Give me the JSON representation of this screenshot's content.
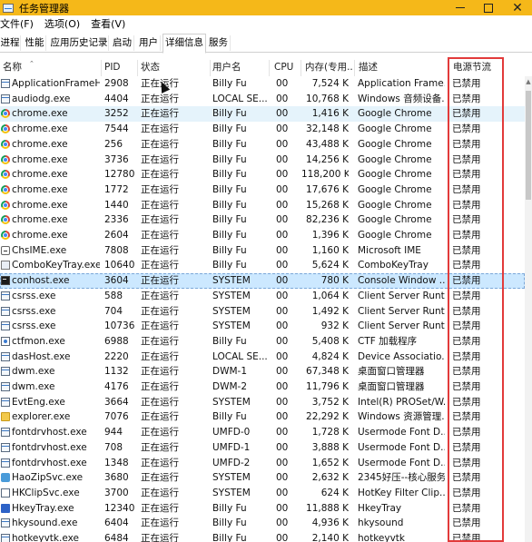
{
  "window": {
    "title": "任务管理器",
    "minimize_icon": "minimize-icon",
    "maximize_icon": "maximize-icon",
    "close_icon": "close-icon",
    "close_glyph": "✕"
  },
  "menu": [
    {
      "label": "文件(F)"
    },
    {
      "label": "选项(O)"
    },
    {
      "label": "查看(V)"
    }
  ],
  "tabs": [
    {
      "label": "进程",
      "active": false
    },
    {
      "label": "性能",
      "active": false
    },
    {
      "label": "应用历史记录",
      "active": false
    },
    {
      "label": "启动",
      "active": false
    },
    {
      "label": "用户",
      "active": false
    },
    {
      "label": "详细信息",
      "active": true
    },
    {
      "label": "服务",
      "active": false
    }
  ],
  "columns": {
    "name": "名称",
    "pid": "PID",
    "status": "状态",
    "user": "用户名",
    "cpu": "CPU",
    "memory": "内存(专用...",
    "desc": "描述",
    "power": "电源节流"
  },
  "highlight_color": "#e23b3b",
  "processes": [
    {
      "name": "ApplicationFrameH...",
      "icon": "generic",
      "pid": "2908",
      "status": "正在运行",
      "user": "Billy Fu",
      "cpu": "00",
      "mem": "7,524 K",
      "desc": "Application Frame...",
      "power": "已禁用"
    },
    {
      "name": "audiodg.exe",
      "icon": "generic",
      "pid": "4404",
      "status": "正在运行",
      "user": "LOCAL SE...",
      "cpu": "00",
      "mem": "10,768 K",
      "desc": "Windows 音频设备...",
      "power": "已禁用"
    },
    {
      "name": "chrome.exe",
      "icon": "chrome",
      "pid": "3252",
      "status": "正在运行",
      "user": "Billy Fu",
      "cpu": "00",
      "mem": "1,416 K",
      "desc": "Google Chrome",
      "power": "已禁用"
    },
    {
      "name": "chrome.exe",
      "icon": "chrome",
      "pid": "7544",
      "status": "正在运行",
      "user": "Billy Fu",
      "cpu": "00",
      "mem": "32,148 K",
      "desc": "Google Chrome",
      "power": "已禁用"
    },
    {
      "name": "chrome.exe",
      "icon": "chrome",
      "pid": "256",
      "status": "正在运行",
      "user": "Billy Fu",
      "cpu": "00",
      "mem": "43,488 K",
      "desc": "Google Chrome",
      "power": "已禁用"
    },
    {
      "name": "chrome.exe",
      "icon": "chrome",
      "pid": "3736",
      "status": "正在运行",
      "user": "Billy Fu",
      "cpu": "00",
      "mem": "14,256 K",
      "desc": "Google Chrome",
      "power": "已禁用"
    },
    {
      "name": "chrome.exe",
      "icon": "chrome",
      "pid": "12780",
      "status": "正在运行",
      "user": "Billy Fu",
      "cpu": "00",
      "mem": "118,200 K",
      "desc": "Google Chrome",
      "power": "已禁用"
    },
    {
      "name": "chrome.exe",
      "icon": "chrome",
      "pid": "1772",
      "status": "正在运行",
      "user": "Billy Fu",
      "cpu": "00",
      "mem": "17,676 K",
      "desc": "Google Chrome",
      "power": "已禁用"
    },
    {
      "name": "chrome.exe",
      "icon": "chrome",
      "pid": "1440",
      "status": "正在运行",
      "user": "Billy Fu",
      "cpu": "00",
      "mem": "15,268 K",
      "desc": "Google Chrome",
      "power": "已禁用"
    },
    {
      "name": "chrome.exe",
      "icon": "chrome",
      "pid": "2336",
      "status": "正在运行",
      "user": "Billy Fu",
      "cpu": "00",
      "mem": "82,236 K",
      "desc": "Google Chrome",
      "power": "已禁用"
    },
    {
      "name": "chrome.exe",
      "icon": "chrome",
      "pid": "2604",
      "status": "正在运行",
      "user": "Billy Fu",
      "cpu": "00",
      "mem": "1,396 K",
      "desc": "Google Chrome",
      "power": "已禁用"
    },
    {
      "name": "ChsIME.exe",
      "icon": "ime",
      "pid": "7808",
      "status": "正在运行",
      "user": "Billy Fu",
      "cpu": "00",
      "mem": "1,160 K",
      "desc": "Microsoft IME",
      "power": "已禁用"
    },
    {
      "name": "ComboKeyTray.exe",
      "icon": "keyb",
      "pid": "10640",
      "status": "正在运行",
      "user": "Billy Fu",
      "cpu": "00",
      "mem": "5,624 K",
      "desc": "ComboKeyTray",
      "power": "已禁用"
    },
    {
      "name": "conhost.exe",
      "icon": "console",
      "pid": "3604",
      "status": "正在运行",
      "user": "SYSTEM",
      "cpu": "00",
      "mem": "780 K",
      "desc": "Console Window ...",
      "power": "已禁用"
    },
    {
      "name": "csrss.exe",
      "icon": "generic",
      "pid": "588",
      "status": "正在运行",
      "user": "SYSTEM",
      "cpu": "00",
      "mem": "1,064 K",
      "desc": "Client Server Runti...",
      "power": "已禁用"
    },
    {
      "name": "csrss.exe",
      "icon": "generic",
      "pid": "704",
      "status": "正在运行",
      "user": "SYSTEM",
      "cpu": "00",
      "mem": "1,492 K",
      "desc": "Client Server Runti...",
      "power": "已禁用"
    },
    {
      "name": "csrss.exe",
      "icon": "generic",
      "pid": "10736",
      "status": "正在运行",
      "user": "SYSTEM",
      "cpu": "00",
      "mem": "932 K",
      "desc": "Client Server Runti...",
      "power": "已禁用"
    },
    {
      "name": "ctfmon.exe",
      "icon": "ctf",
      "pid": "6988",
      "status": "正在运行",
      "user": "Billy Fu",
      "cpu": "00",
      "mem": "5,408 K",
      "desc": "CTF 加载程序",
      "power": "已禁用"
    },
    {
      "name": "dasHost.exe",
      "icon": "generic",
      "pid": "2220",
      "status": "正在运行",
      "user": "LOCAL SE...",
      "cpu": "00",
      "mem": "4,824 K",
      "desc": "Device Associatio...",
      "power": "已禁用"
    },
    {
      "name": "dwm.exe",
      "icon": "generic",
      "pid": "1132",
      "status": "正在运行",
      "user": "DWM-1",
      "cpu": "00",
      "mem": "67,348 K",
      "desc": "桌面窗口管理器",
      "power": "已禁用"
    },
    {
      "name": "dwm.exe",
      "icon": "generic",
      "pid": "4176",
      "status": "正在运行",
      "user": "DWM-2",
      "cpu": "00",
      "mem": "11,796 K",
      "desc": "桌面窗口管理器",
      "power": "已禁用"
    },
    {
      "name": "EvtEng.exe",
      "icon": "generic",
      "pid": "3664",
      "status": "正在运行",
      "user": "SYSTEM",
      "cpu": "00",
      "mem": "3,752 K",
      "desc": "Intel(R) PROSet/W...",
      "power": "已禁用"
    },
    {
      "name": "explorer.exe",
      "icon": "folder",
      "pid": "7076",
      "status": "正在运行",
      "user": "Billy Fu",
      "cpu": "00",
      "mem": "22,292 K",
      "desc": "Windows 资源管理...",
      "power": "已禁用"
    },
    {
      "name": "fontdrvhost.exe",
      "icon": "generic",
      "pid": "944",
      "status": "正在运行",
      "user": "UMFD-0",
      "cpu": "00",
      "mem": "1,728 K",
      "desc": "Usermode Font D...",
      "power": "已禁用"
    },
    {
      "name": "fontdrvhost.exe",
      "icon": "generic",
      "pid": "708",
      "status": "正在运行",
      "user": "UMFD-1",
      "cpu": "00",
      "mem": "3,888 K",
      "desc": "Usermode Font D...",
      "power": "已禁用"
    },
    {
      "name": "fontdrvhost.exe",
      "icon": "generic",
      "pid": "1348",
      "status": "正在运行",
      "user": "UMFD-2",
      "cpu": "00",
      "mem": "1,652 K",
      "desc": "Usermode Font D...",
      "power": "已禁用"
    },
    {
      "name": "HaoZipSvc.exe",
      "icon": "haozip",
      "pid": "3680",
      "status": "正在运行",
      "user": "SYSTEM",
      "cpu": "00",
      "mem": "2,632 K",
      "desc": "2345好压--核心服务",
      "power": "已禁用"
    },
    {
      "name": "HKClipSvc.exe",
      "icon": "hkclip",
      "pid": "3700",
      "status": "正在运行",
      "user": "SYSTEM",
      "cpu": "00",
      "mem": "624 K",
      "desc": "HotKey Filter Clip...",
      "power": "已禁用"
    },
    {
      "name": "HkeyTray.exe",
      "icon": "hk",
      "pid": "12340",
      "status": "正在运行",
      "user": "Billy Fu",
      "cpu": "00",
      "mem": "11,888 K",
      "desc": "HkeyTray",
      "power": "已禁用"
    },
    {
      "name": "hkysound.exe",
      "icon": "generic",
      "pid": "6404",
      "status": "正在运行",
      "user": "Billy Fu",
      "cpu": "00",
      "mem": "4,936 K",
      "desc": "hkysound",
      "power": "已禁用"
    },
    {
      "name": "hotkeyvtk.exe",
      "icon": "generic",
      "pid": "6484",
      "status": "正在运行",
      "user": "Billy Fu",
      "cpu": "00",
      "mem": "2,140 K",
      "desc": "hotkeyvtk",
      "power": "已禁用"
    }
  ]
}
